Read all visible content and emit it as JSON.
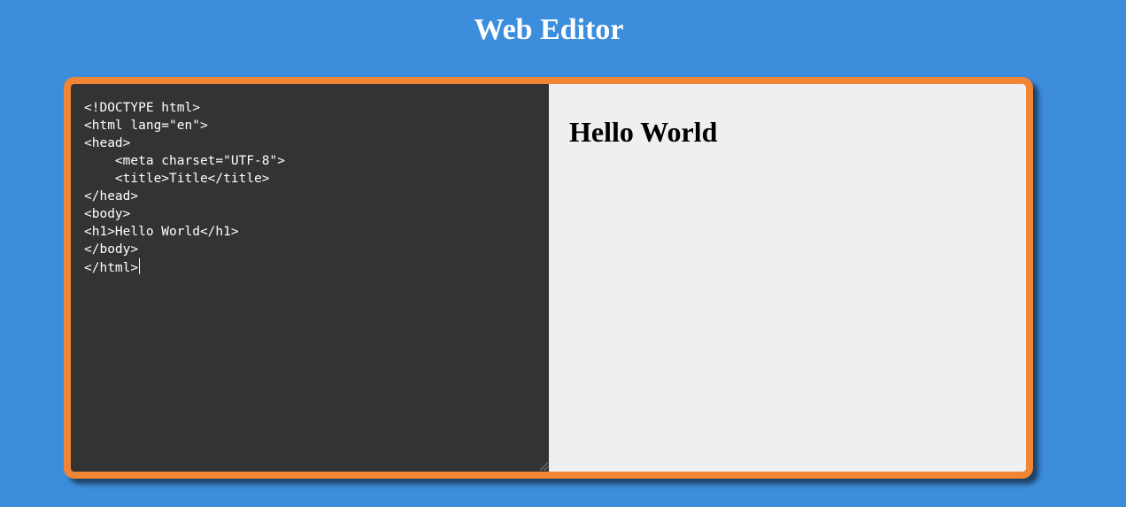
{
  "header": {
    "title": "Web Editor"
  },
  "editor": {
    "code_lines": [
      "<!DOCTYPE html>",
      "<html lang=\"en\">",
      "<head>",
      "    <meta charset=\"UTF-8\">",
      "    <title>Title</title>",
      "</head>",
      "<body>",
      "<h1>Hello World</h1>",
      "</body>",
      "</html>"
    ]
  },
  "preview": {
    "heading": "Hello World"
  },
  "colors": {
    "background": "#3d8ddd",
    "frame_border": "#f08535",
    "code_background": "#333333",
    "preview_background": "#efefef"
  }
}
